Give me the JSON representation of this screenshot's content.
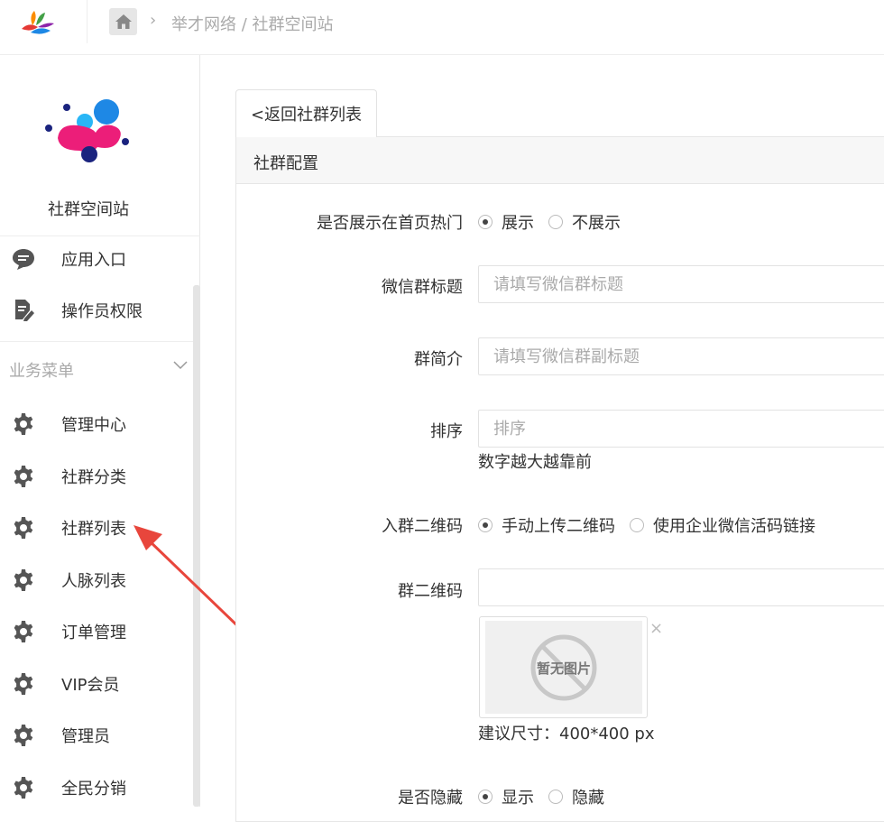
{
  "header": {
    "breadcrumb": "举才网络 / 社群空间站",
    "breadcrumb_separator": "›"
  },
  "sidebar": {
    "brand_name": "社群空间站",
    "top_items": [
      {
        "label": "应用入口",
        "icon": "chat-bubble-icon"
      },
      {
        "label": "操作员权限",
        "icon": "document-edit-icon"
      }
    ],
    "section_title": "业务菜单",
    "menu_items": [
      {
        "label": "管理中心",
        "icon": "gear-icon"
      },
      {
        "label": "社群分类",
        "icon": "gear-icon"
      },
      {
        "label": "社群列表",
        "icon": "gear-icon"
      },
      {
        "label": "人脉列表",
        "icon": "gear-icon"
      },
      {
        "label": "订单管理",
        "icon": "gear-icon"
      },
      {
        "label": "VIP会员",
        "icon": "gear-icon"
      },
      {
        "label": "管理员",
        "icon": "gear-icon"
      },
      {
        "label": "全民分销",
        "icon": "gear-icon"
      }
    ]
  },
  "main": {
    "back_tab": "<返回社群列表",
    "panel_title": "社群配置",
    "form": {
      "show_on_home": {
        "label": "是否展示在首页热门",
        "options": [
          "展示",
          "不展示"
        ],
        "selected": "展示"
      },
      "wechat_title": {
        "label": "微信群标题",
        "placeholder": "请填写微信群标题",
        "value": ""
      },
      "intro": {
        "label": "群简介",
        "placeholder": "请填写微信群副标题",
        "value": ""
      },
      "sort": {
        "label": "排序",
        "placeholder": "排序",
        "value": "",
        "hint": "数字越大越靠前"
      },
      "qr_mode": {
        "label": "入群二维码",
        "options": [
          "手动上传二维码",
          "使用企业微信活码链接"
        ],
        "selected": "手动上传二维码"
      },
      "qr_code": {
        "label": "群二维码",
        "value": "",
        "no_image": "暂无图片",
        "remove": "×",
        "size_hint": "建议尺寸：400*400 px"
      },
      "hidden": {
        "label": "是否隐藏",
        "options": [
          "显示",
          "隐藏"
        ],
        "selected": "显示"
      }
    }
  },
  "colors": {
    "annotation_arrow": "#e8463c",
    "panel_header_bg": "#f7f7f7",
    "icon_gray": "#555555"
  }
}
